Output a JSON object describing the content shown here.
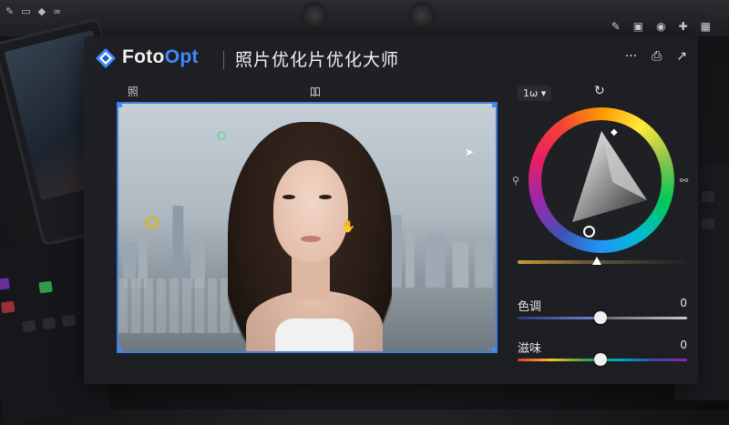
{
  "app": {
    "name_prefix": "Foto",
    "name_suffix": "Opt",
    "subtitle": "照片优化片优化大师"
  },
  "canvas": {
    "label_left": "照",
    "label_right": "吅"
  },
  "panel": {
    "zoom": "1ѡ",
    "sliders": [
      {
        "label": "色调",
        "value": "0",
        "level": 0.49
      },
      {
        "label": "滋味",
        "value": "0",
        "level": 0.49
      }
    ]
  },
  "colors": {
    "accent": "#3c8cff",
    "selection": "#3d7fe0",
    "panel_bg": "#1f2023"
  },
  "icons": {
    "title_actions": [
      "more-icon",
      "print-icon",
      "share-icon"
    ],
    "top_left": [
      "pen-icon",
      "brush-icon",
      "shape-icon",
      "link-icon"
    ],
    "top_right": [
      "edit-icon",
      "box-icon",
      "camera-icon",
      "plus-icon",
      "grid-icon"
    ]
  }
}
